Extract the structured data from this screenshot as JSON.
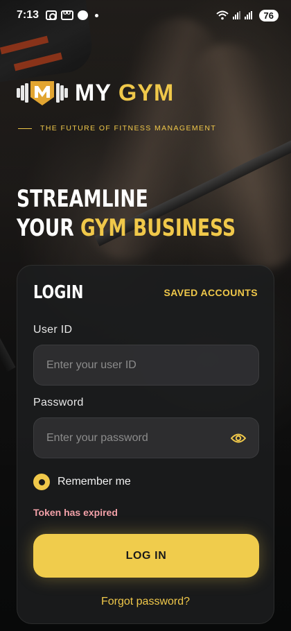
{
  "status_bar": {
    "time": "7:13",
    "battery": "76"
  },
  "brand": {
    "name_part1": "MY",
    "name_part2": "GYM",
    "tagline": "THE FUTURE OF FITNESS MANAGEMENT",
    "logo_letter": "M",
    "accent_color": "#f0c84a"
  },
  "headline": {
    "line1": "STREAMLINE",
    "line2_prefix": "YOUR ",
    "line2_accent": "GYM BUSINESS"
  },
  "login": {
    "title": "LOGIN",
    "saved_accounts": "SAVED ACCOUNTS",
    "user_id_label": "User ID",
    "user_id_placeholder": "Enter your user ID",
    "user_id_value": "",
    "password_label": "Password",
    "password_placeholder": "Enter your password",
    "password_value": "",
    "remember_label": "Remember me",
    "remember_checked": true,
    "error_text": "Token has expired",
    "error_color": "#f3a1a8",
    "submit_label": "LOG IN",
    "forgot_label": "Forgot password?"
  },
  "icons": {
    "password_toggle": "eye-icon",
    "logo": "dumbbell-shield-logo-icon"
  }
}
